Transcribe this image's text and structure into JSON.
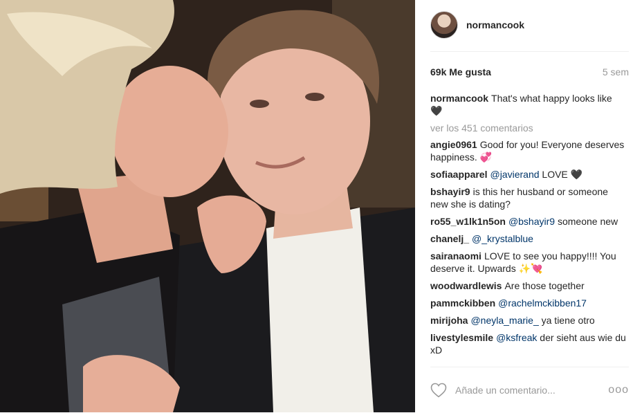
{
  "post": {
    "username": "normancook",
    "likes": "69k Me gusta",
    "time": "5 sem",
    "caption": {
      "user": "normancook",
      "text": "That's what happy looks like 🖤"
    },
    "view_all": "ver los 451 comentarios",
    "comments": [
      {
        "user": "angie0961",
        "text": "Good for you! Everyone deserves happiness. 💞"
      },
      {
        "user": "sofiaapparel",
        "mention": "@javierand",
        "text": " LOVE 🖤"
      },
      {
        "user": "bshayir9",
        "text": "is this her husband or someone new she is dating?"
      },
      {
        "user": "ro55_w1lk1n5on",
        "mention": "@bshayir9",
        "text": " someone new"
      },
      {
        "user": "chanelj_",
        "mention": "@_krystalblue",
        "text": ""
      },
      {
        "user": "sairanaomi",
        "text": "LOVE to see you happy!!!! You deserve it. Upwards ✨💘"
      },
      {
        "user": "woodwardlewis",
        "text": "Are those together"
      },
      {
        "user": "pammckibben",
        "mention": "@rachelmckibben17",
        "text": ""
      },
      {
        "user": "mirijoha",
        "mention": "@neyla_marie_",
        "text": " ya tiene otro"
      },
      {
        "user": "livestylesmile",
        "mention": "@ksfreak",
        "text": " der sieht aus wie du xD"
      }
    ],
    "comment_placeholder": "Añade un comentario...",
    "more_label": "ooo"
  },
  "icons": {
    "like": "heart-outline-icon",
    "more": "more-options-icon"
  },
  "colors": {
    "mention": "#003569",
    "muted": "#999999",
    "text": "#262626"
  }
}
